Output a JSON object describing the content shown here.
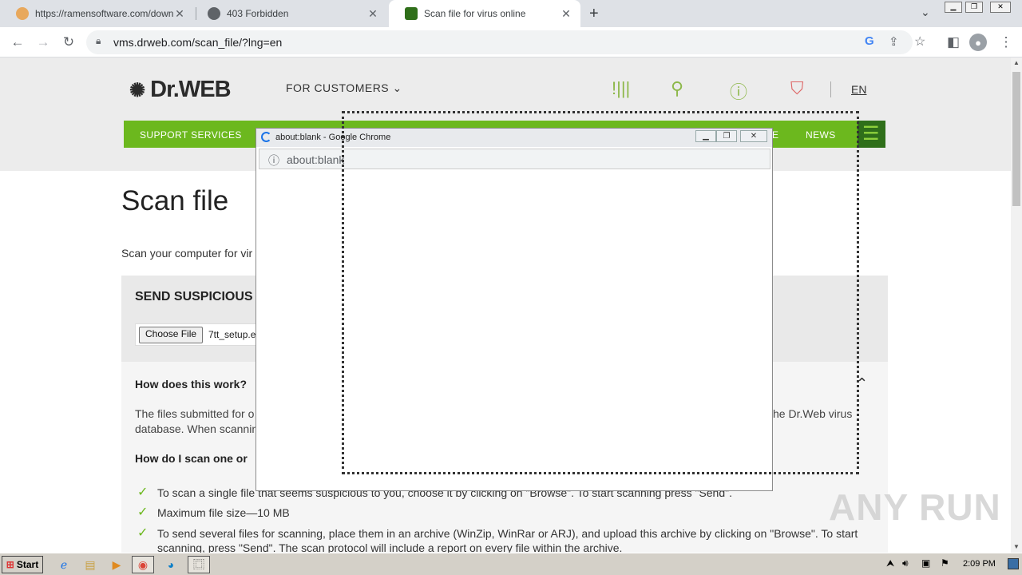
{
  "browser": {
    "tabs": [
      {
        "title": "https://ramensoftware.com/downlo",
        "active": false
      },
      {
        "title": "403 Forbidden",
        "active": false
      },
      {
        "title": "Scan file for virus online",
        "active": true
      }
    ],
    "new_tab_icon": "plus-icon",
    "url": "vms.drweb.com/scan_file/?lng=en"
  },
  "site": {
    "logo": "Dr.WEB",
    "for_customers": "FOR CUSTOMERS",
    "lang": "EN",
    "nav": {
      "support": "SUPPORT SERVICES",
      "item_e": "E",
      "news": "NEWS"
    },
    "brand_green": "#6cb81e"
  },
  "main": {
    "heading": "Scan file",
    "intro": "Scan your computer for vir",
    "panel_title": "SEND SUSPICIOUS",
    "choose_file": "Choose File",
    "file_name": "7tt_setup.e",
    "q1": "How does this work?",
    "p1_left": "The files submitted for o",
    "p1_right": "he Dr.Web virus",
    "p1_line2": "database. When scannin",
    "q2": "How do I scan one or",
    "bullets": [
      "To scan a single file that seems suspicious to you, choose it by clicking on \"Browse\". To start scanning press \"Send\".",
      "Maximum file size—10 MB",
      "To send several files for scanning, place them in an archive (WinZip, WinRar or ARJ), and upload this archive by clicking on \"Browse\". To start",
      "scanning, press \"Send\". The scan protocol will include a report on every file within the archive."
    ]
  },
  "popup": {
    "title": "about:blank - Google Chrome",
    "url": "about:blank"
  },
  "taskbar": {
    "start": "Start",
    "clock": "2:09 PM"
  },
  "watermark": "ANY RUN"
}
